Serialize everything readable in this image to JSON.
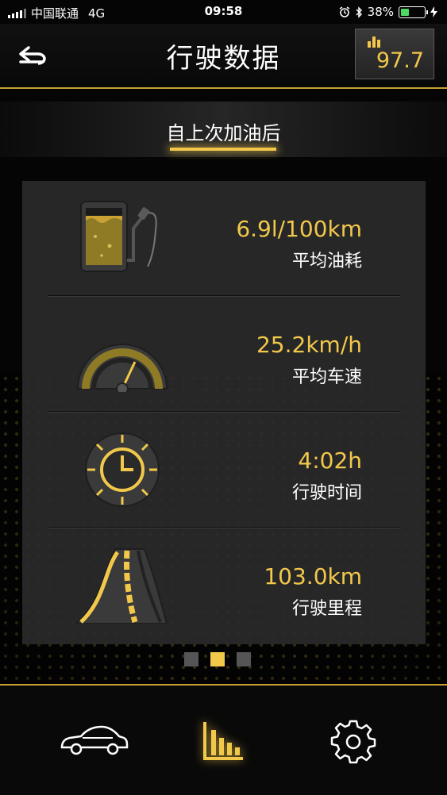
{
  "status_bar": {
    "carrier": "中国联通",
    "network": "4G",
    "time": "09:58",
    "battery": "38%",
    "battery_level": 0.38
  },
  "header": {
    "title": "行驶数据",
    "octane_value": "97.7"
  },
  "tab": {
    "label": "自上次加油后"
  },
  "stats": [
    {
      "icon": "fuel-pump-icon",
      "value": "6.9l/100km",
      "label": "平均油耗"
    },
    {
      "icon": "speedometer-icon",
      "value": "25.2km/h",
      "label": "平均车速"
    },
    {
      "icon": "clock-icon",
      "value": "4:02h",
      "label": "行驶时间"
    },
    {
      "icon": "road-icon",
      "value": "103.0km",
      "label": "行驶里程"
    }
  ],
  "pager": {
    "pages": 3,
    "active_index": 1
  },
  "bottom_nav": [
    {
      "icon": "car-icon"
    },
    {
      "icon": "bar-chart-icon",
      "active": true
    },
    {
      "icon": "gear-icon"
    }
  ],
  "colors": {
    "accent": "#f2c84b",
    "panel": "#2a2a2a",
    "background": "#050505"
  }
}
